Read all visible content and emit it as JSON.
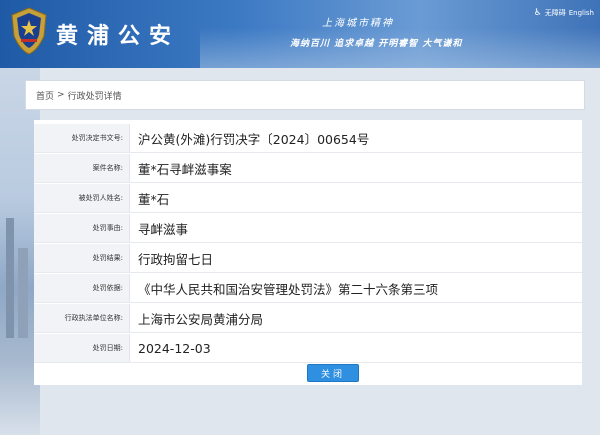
{
  "header": {
    "site_title": "黄浦公安",
    "slogan_line1": "上海城市精神",
    "slogan_line2": "海纳百川 追求卓越 开明睿智 大气谦和",
    "accessibility": "无障碍",
    "language": "English"
  },
  "breadcrumb": {
    "home": "首页",
    "separator": ">",
    "current": "行政处罚详情"
  },
  "details": [
    {
      "label": "处罚决定书文号:",
      "value": "沪公黄(外滩)行罚决字〔2024〕00654号"
    },
    {
      "label": "案件名称:",
      "value": "董*石寻衅滋事案"
    },
    {
      "label": "被处罚人姓名:",
      "value": "董*石"
    },
    {
      "label": "处罚事由:",
      "value": "寻衅滋事"
    },
    {
      "label": "处罚结果:",
      "value": "行政拘留七日"
    },
    {
      "label": "处罚依据:",
      "value": "《中华人民共和国治安管理处罚法》第二十六条第三项"
    },
    {
      "label": "行政执法单位名称:",
      "value": "上海市公安局黄浦分局"
    },
    {
      "label": "处罚日期:",
      "value": "2024-12-03"
    }
  ],
  "close_label": "关闭",
  "colors": {
    "header_blue": "#1f5aa6",
    "button_blue": "#2f8fe0",
    "label_bg": "#f1f3f6"
  }
}
